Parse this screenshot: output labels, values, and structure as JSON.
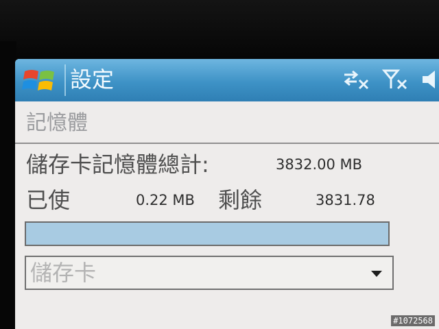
{
  "titlebar": {
    "title": "設定",
    "start_icon": "windows-flag-icon",
    "status_icons": [
      "connectivity-icon",
      "signal-off-icon",
      "speaker-icon"
    ]
  },
  "section": {
    "title": "記憶體"
  },
  "storage": {
    "total_label": "儲存卡記憶體總計:",
    "total_value": "3832.00 MB",
    "used_label": "已使",
    "used_value": "0.22 MB",
    "free_label": "剩餘",
    "free_value": "3831.78"
  },
  "usage_bar": {
    "fill_fraction": 1.0
  },
  "location_select": {
    "selected": "儲存卡"
  },
  "watermark": "#1072568",
  "colors": {
    "titlebar": "#3e92c6",
    "bar_fill": "#a8cbe2"
  }
}
